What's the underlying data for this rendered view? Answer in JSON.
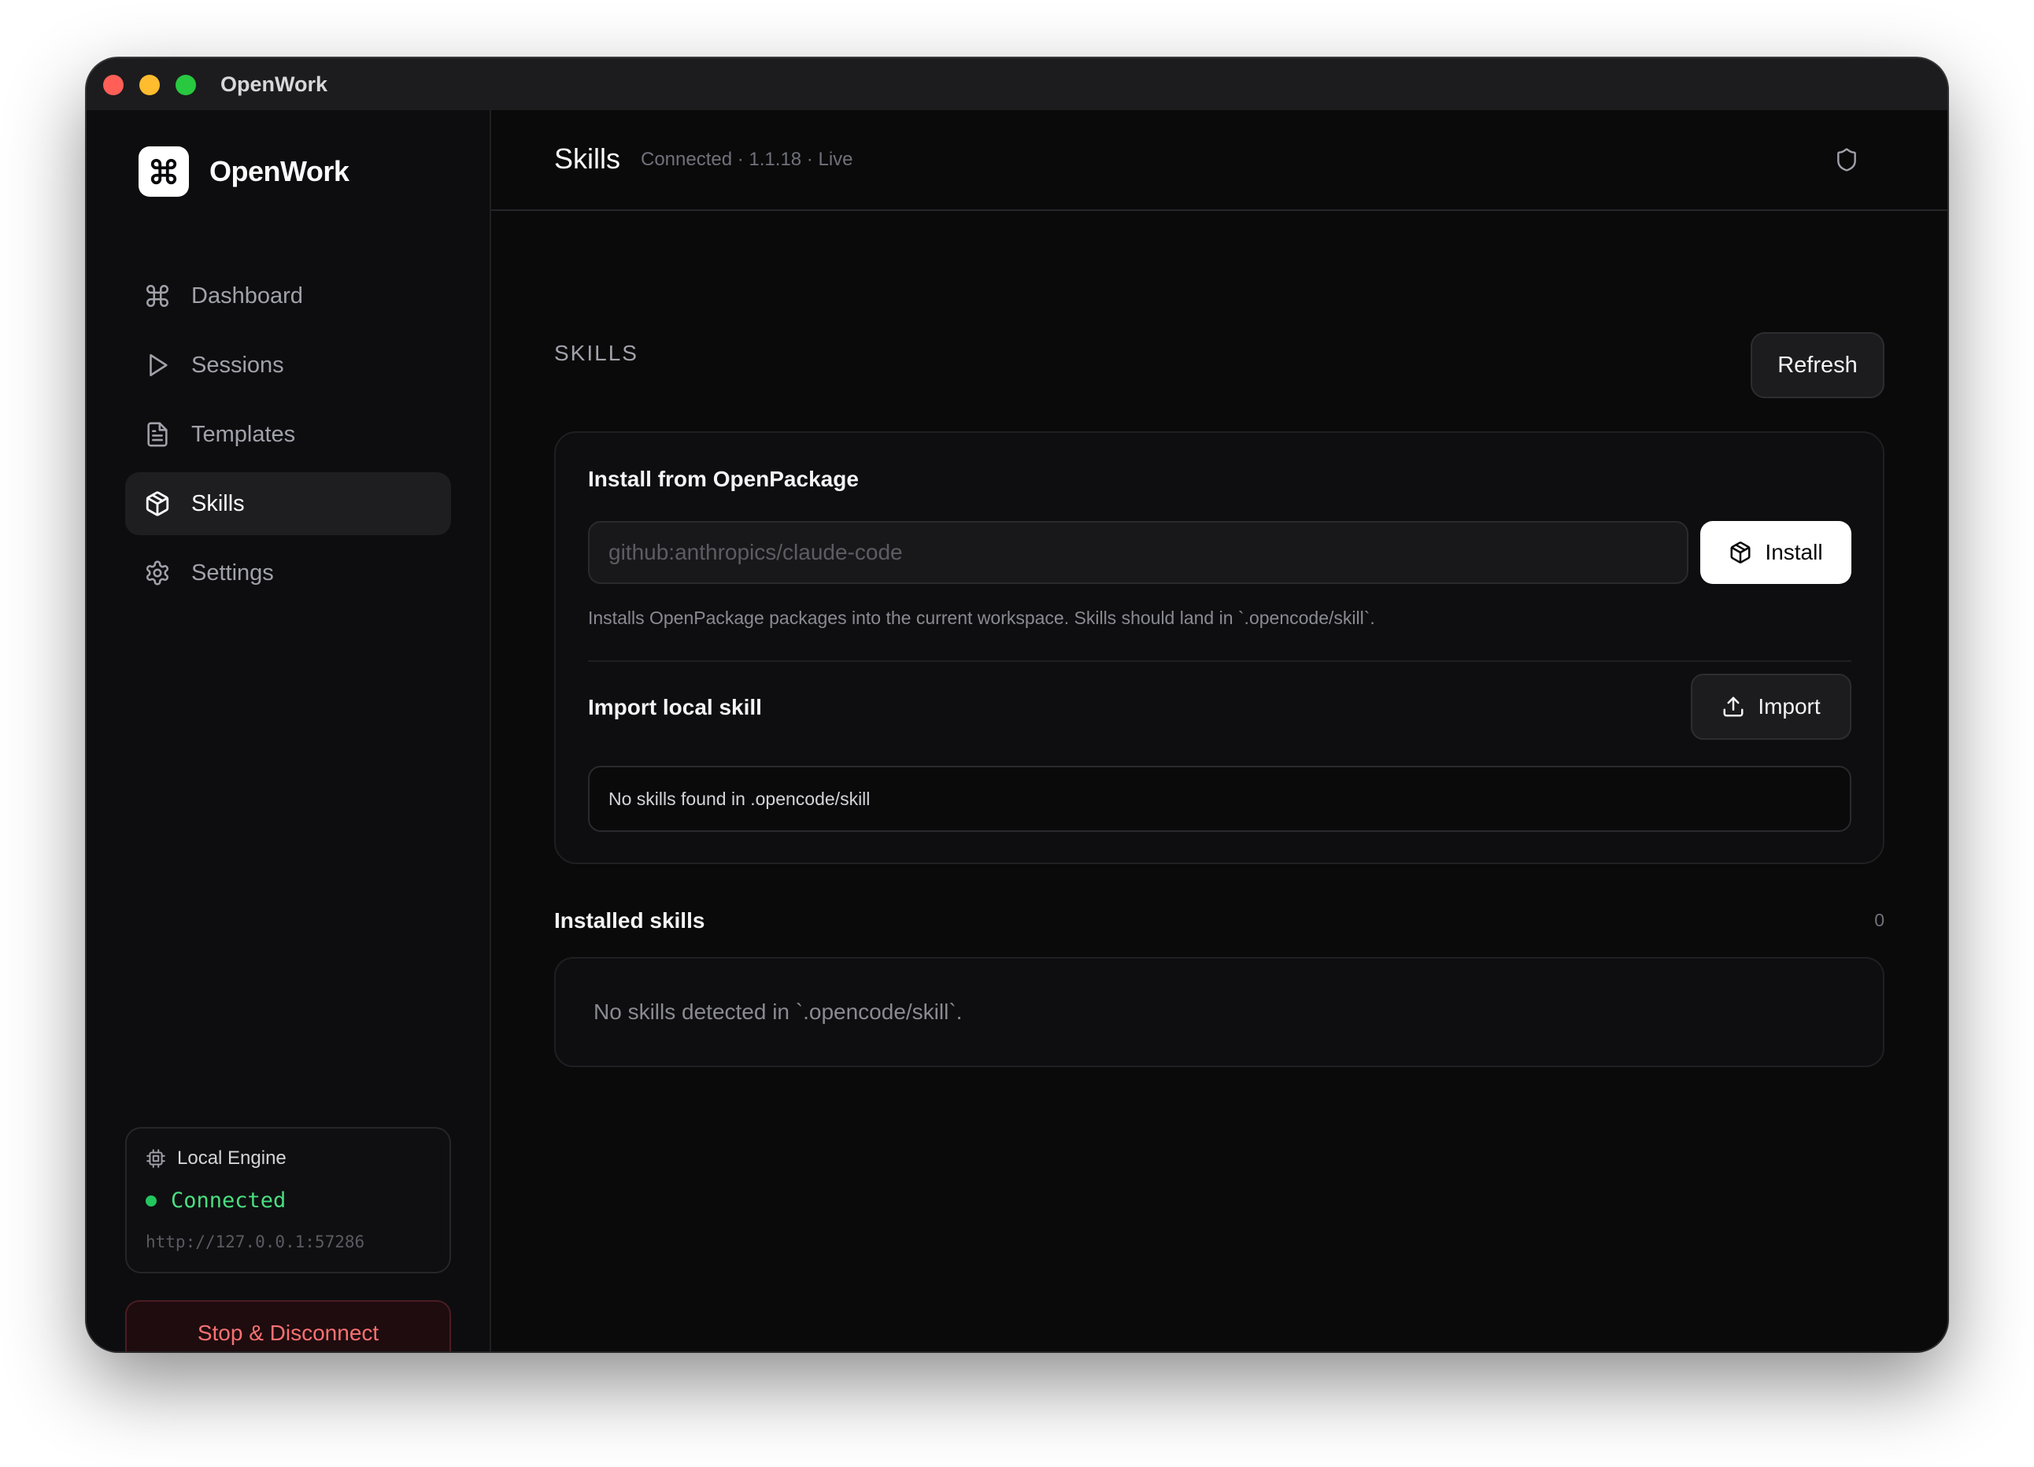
{
  "window": {
    "title": "OpenWork"
  },
  "sidebar": {
    "brand": "OpenWork",
    "items": [
      {
        "label": "Dashboard",
        "icon": "command-icon",
        "active": false
      },
      {
        "label": "Sessions",
        "icon": "play-icon",
        "active": false
      },
      {
        "label": "Templates",
        "icon": "file-text-icon",
        "active": false
      },
      {
        "label": "Skills",
        "icon": "package-icon",
        "active": true
      },
      {
        "label": "Settings",
        "icon": "gear-icon",
        "active": false
      }
    ],
    "engine": {
      "title": "Local Engine",
      "status": "Connected",
      "url": "http://127.0.0.1:57286"
    },
    "stop_label": "Stop & Disconnect"
  },
  "header": {
    "title": "Skills",
    "status": "Connected · 1.1.18 · Live"
  },
  "skills": {
    "section_label": "SKILLS",
    "refresh_label": "Refresh",
    "install": {
      "heading": "Install from OpenPackage",
      "placeholder": "github:anthropics/claude-code",
      "value": "",
      "button_label": "Install",
      "help": "Installs OpenPackage packages into the current workspace. Skills should land in `.opencode/skill`."
    },
    "import": {
      "heading": "Import local skill",
      "button_label": "Import",
      "empty_text": "No skills found in .opencode/skill"
    },
    "installed": {
      "heading": "Installed skills",
      "count": "0",
      "empty_text": "No skills detected in `.opencode/skill`."
    }
  },
  "colors": {
    "background": "#0a0a0b",
    "sidebar": "#0d0d0f",
    "accent_green": "#22c55e",
    "danger": "#f87171"
  }
}
